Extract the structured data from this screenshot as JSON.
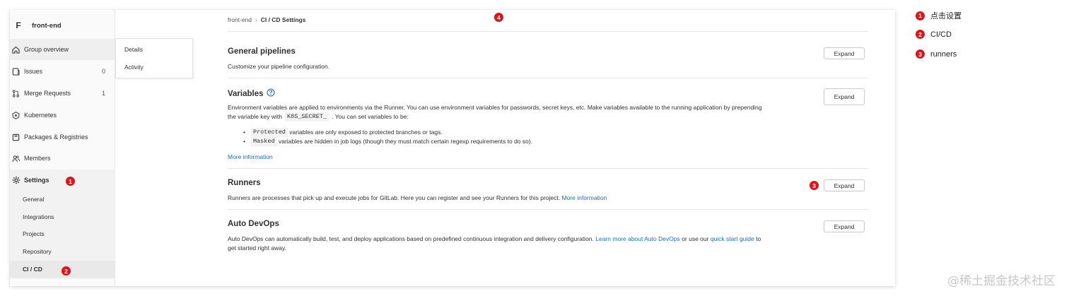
{
  "sidebar": {
    "avatar_letter": "F",
    "group_name": "front-end",
    "items": [
      {
        "label": "Group overview",
        "icon": "home-icon",
        "count": ""
      },
      {
        "label": "Issues",
        "icon": "issues-icon",
        "count": "0"
      },
      {
        "label": "Merge Requests",
        "icon": "merge-request-icon",
        "count": "1"
      },
      {
        "label": "Kubernetes",
        "icon": "kubernetes-icon",
        "count": ""
      },
      {
        "label": "Packages & Registries",
        "icon": "package-icon",
        "count": ""
      },
      {
        "label": "Members",
        "icon": "users-icon",
        "count": ""
      },
      {
        "label": "Settings",
        "icon": "gear-icon",
        "count": ""
      }
    ],
    "settings_sub": [
      "General",
      "Integrations",
      "Projects",
      "Repository",
      "CI / CD"
    ]
  },
  "flyout": {
    "items": [
      "Details",
      "Activity"
    ]
  },
  "breadcrumb": {
    "parent": "front-end",
    "current": "CI / CD Settings"
  },
  "sections": {
    "general": {
      "title": "General pipelines",
      "desc": "Customize your pipeline configuration.",
      "button": "Expand"
    },
    "variables": {
      "title": "Variables",
      "desc_line1": "Environment variables are applied to environments via the Runner. You can use environment variables for passwords, secret keys, etc. Make variables available to the running application by prepending",
      "desc_line2_pre": "the variable key with",
      "code_prefix": "K8S_SECRET_",
      "desc_line2_post": ". You can set variables to be:",
      "bullet1_code": "Protected",
      "bullet1_text": "variables are only exposed to protected branches or tags.",
      "bullet2_code": "Masked",
      "bullet2_text": "variables are hidden in job logs (though they must match certain regexp requirements to do so).",
      "more_link": "More information",
      "button": "Expand"
    },
    "runners": {
      "title": "Runners",
      "desc": "Runners are processes that pick up and execute jobs for GitLab. Here you can register and see your Runners for this project.",
      "more_link": "More information",
      "button": "Expand"
    },
    "devops": {
      "title": "Auto DevOps",
      "desc_pre": "Auto DevOps can automatically build, test, and deploy applications based on predefined continuous integration and delivery configuration.",
      "link1": "Learn more about Auto DevOps",
      "mid": "or use our",
      "link2": "quick start guide",
      "post": "to",
      "line2": "get started right away.",
      "button": "Expand"
    }
  },
  "markers": {
    "m1": "1",
    "m2": "2",
    "m3": "3",
    "m4": "4"
  },
  "legend": [
    {
      "num": "1",
      "text": "点击设置"
    },
    {
      "num": "2",
      "text": "CI/CD"
    },
    {
      "num": "3",
      "text": "runners"
    }
  ],
  "watermark": "@稀土掘金技术社区",
  "colors": {
    "marker": "#d9161b",
    "link": "#1f6bbf"
  }
}
